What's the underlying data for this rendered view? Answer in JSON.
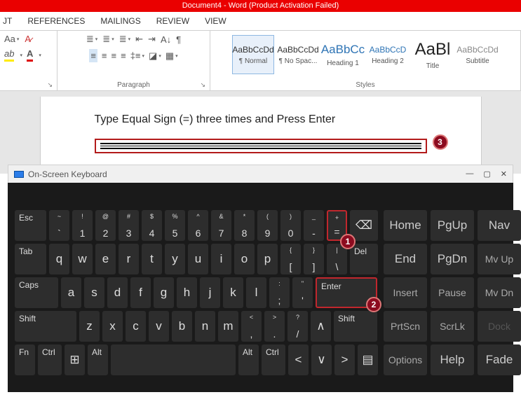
{
  "title": "Document4 -  Word (Product Activation Failed)",
  "tabs": [
    "JT",
    "REFERENCES",
    "MAILINGS",
    "REVIEW",
    "VIEW"
  ],
  "groups": {
    "paragraph": "Paragraph",
    "styles": "Styles"
  },
  "styles": [
    {
      "preview": "AaBbCcDd",
      "label": "¶ Normal"
    },
    {
      "preview": "AaBbCcDd",
      "label": "¶ No Spac..."
    },
    {
      "preview": "AaBbCc",
      "label": "Heading 1"
    },
    {
      "preview": "AaBbCcD",
      "label": "Heading 2"
    },
    {
      "preview": "AaBl",
      "label": "Title"
    },
    {
      "preview": "AaBbCcDd",
      "label": "Subtitle"
    }
  ],
  "instruction": "Type Equal Sign (=) three times and Press Enter",
  "osk_title": "On-Screen Keyboard",
  "callouts": {
    "equals": "1",
    "enter": "2",
    "result": "3"
  },
  "keys": {
    "row1": [
      "Esc",
      "~ `",
      "! 1",
      "@ 2",
      "# 3",
      "$ 4",
      "% 5",
      "^ 6",
      "& 7",
      "* 8",
      "( 9",
      ") 0",
      "_ -",
      "+ ="
    ],
    "bksp": "⌫",
    "row2": [
      "Tab",
      "q",
      "w",
      "e",
      "r",
      "t",
      "y",
      "u",
      "i",
      "o",
      "p",
      "{ [",
      "} ]",
      "| \\",
      "Del"
    ],
    "row3": [
      "Caps",
      "a",
      "s",
      "d",
      "f",
      "g",
      "h",
      "j",
      "k",
      "l",
      ": ;",
      "\" '",
      "Enter",
      "Insert"
    ],
    "row4": [
      "Shift",
      "z",
      "x",
      "c",
      "v",
      "b",
      "n",
      "m",
      "< ,",
      "> .",
      "? /",
      "↑",
      "Shift",
      "PrtScn"
    ],
    "row5": [
      "Fn",
      "Ctrl",
      "⊞",
      "Alt",
      "",
      "Alt",
      "Ctrl",
      "<",
      "∨",
      ">",
      "▤",
      "Options"
    ],
    "nav1": [
      "Home",
      "End",
      "Pause",
      "ScrLk",
      "Help"
    ],
    "nav2": [
      "PgUp",
      "PgDn"
    ],
    "nav3": [
      "Nav",
      "Mv Up",
      "Mv Dn",
      "Dock",
      "Fade"
    ]
  }
}
